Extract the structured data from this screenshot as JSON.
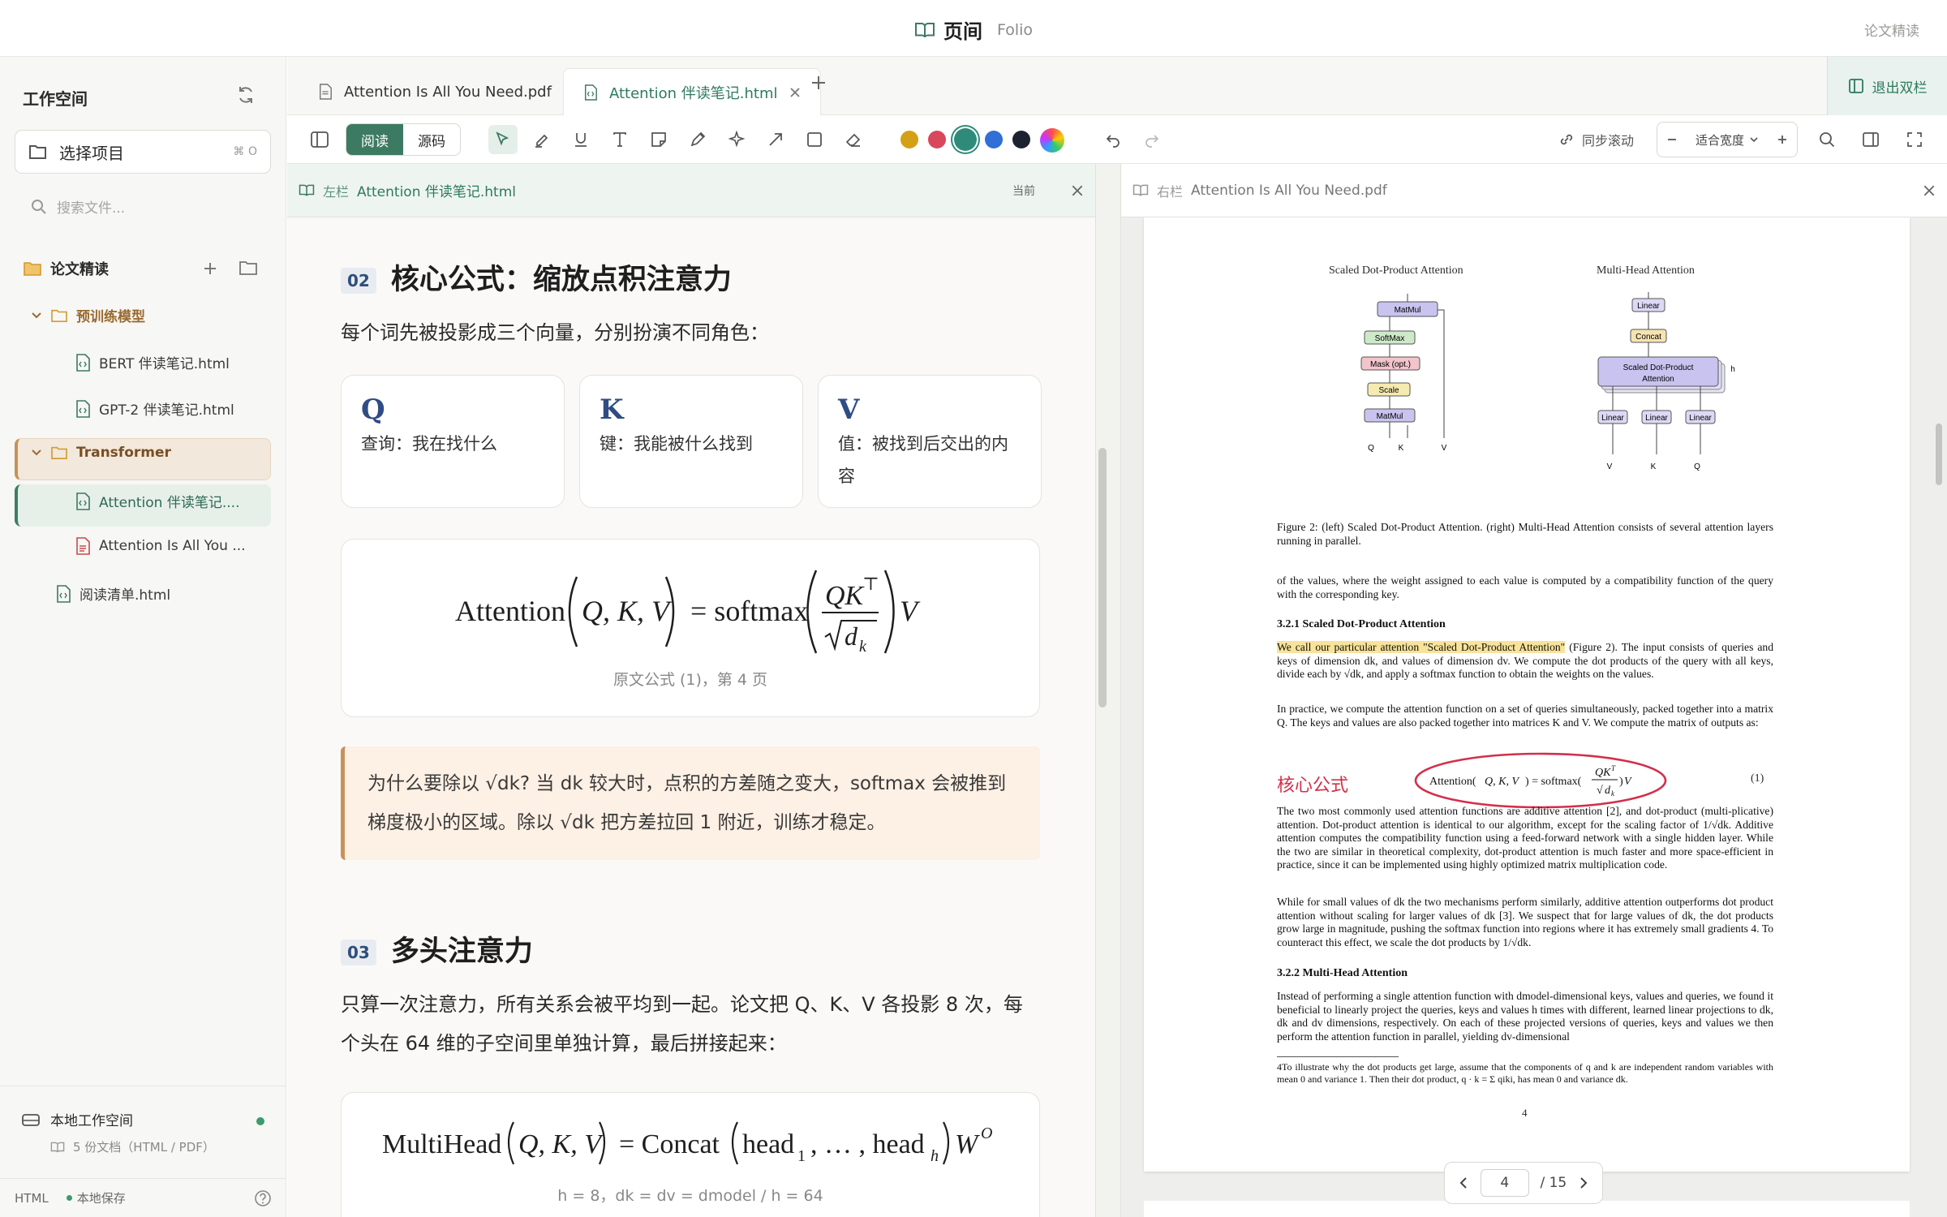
{
  "app": {
    "icon": "book-open-icon",
    "title": "页间",
    "subtitle": "Folio",
    "mode_label": "论文精读",
    "accent": "#3d7a62"
  },
  "sidebar": {
    "title": "工作空间",
    "project_selector": {
      "label": "选择项目",
      "shortcut": "⌘ O"
    },
    "search_placeholder": "搜索文件...",
    "group": "论文精读",
    "items": [
      {
        "label": "预训练模型",
        "type": "folder"
      },
      {
        "label": "BERT 伴读笔记.html",
        "type": "html"
      },
      {
        "label": "GPT-2 伴读笔记.html",
        "type": "html"
      },
      {
        "label": "Transformer",
        "type": "folder"
      },
      {
        "label": "Attention 伴读笔记....",
        "type": "html"
      },
      {
        "label": "Attention Is All You ...",
        "type": "pdf"
      },
      {
        "label": "阅读清单.html",
        "type": "html"
      }
    ],
    "workspace": {
      "name": "本地工作空间",
      "meta": "5 份文档（HTML / PDF）"
    },
    "status": {
      "format": "HTML",
      "save": "本地保存"
    }
  },
  "tabs": [
    {
      "label": "Attention Is All You Need.pdf"
    },
    {
      "label": "Attention 伴读笔记.html"
    }
  ],
  "exit_dual": "退出双栏",
  "toolbar": {
    "mode_read": "阅读",
    "mode_source": "源码",
    "colors": [
      "#d4a017",
      "#d9475a",
      "#2e8b7a",
      "#2f6fd6",
      "#1d2230"
    ],
    "sync_scroll": "同步滚动",
    "zoom": "适合宽度"
  },
  "left_pane": {
    "side": "左栏",
    "file": "Attention 伴读笔记.html",
    "current": "当前",
    "sec2_num": "02",
    "sec2_title": "核心公式：缩放点积注意力",
    "sec2_intro": "每个词先被投影成三个向量，分别扮演不同角色：",
    "q": {
      "letter": "Q",
      "desc": "查询：我在找什么"
    },
    "k": {
      "letter": "K",
      "desc": "键：我能被什么找到"
    },
    "v": {
      "letter": "V",
      "desc": "值：被找到后交出的内容"
    },
    "formula_caption": "原文公式 (1)，第 4 页",
    "note": "为什么要除以 √dk? 当 dk 较大时，点积的方差随之变大，softmax 会被推到梯度极小的区域。除以 √dk 把方差拉回 1 附近，训练才稳定。",
    "sec3_num": "03",
    "sec3_title": "多头注意力",
    "sec3_para": "只算一次注意力，所有关系会被平均到一起。论文把 Q、K、V 各投影 8 次，每个头在 64 维的子空间里单独计算，最后拼接起来：",
    "mh_caption": "h = 8，dk = dv = dmodel / h = 64"
  },
  "right_pane": {
    "side": "右栏",
    "file": "Attention Is All You Need.pdf",
    "fig_left_title": "Scaled Dot-Product Attention",
    "fig_right_title": "Multi-Head Attention",
    "fig_caption": "Figure 2: (left) Scaled Dot-Product Attention. (right) Multi-Head Attention consists of several attention layers running in parallel.",
    "p1": "of the values, where the weight assigned to each value is computed by a compatibility function of the query with the corresponding key.",
    "h321": "3.2.1   Scaled Dot-Product Attention",
    "p2_highlight": "We call our particular attention \"Scaled Dot-Product Attention\"",
    "p2_rest": " (Figure 2). The input consists of queries and keys of dimension dk, and values of dimension dv. We compute the dot products of the query with all keys, divide each by √dk, and apply a softmax function to obtain the weights on the values.",
    "p3": "In practice, we compute the attention function on a set of queries simultaneously, packed together into a matrix Q. The keys and values are also packed together into matrices K and V. We compute the matrix of outputs as:",
    "annotation": "核心公式",
    "eq_num": "(1)",
    "p4": "The two most commonly used attention functions are additive attention [2], and dot-product (multi-plicative) attention. Dot-product attention is identical to our algorithm, except for the scaling factor of 1/√dk. Additive attention computes the compatibility function using a feed-forward network with a single hidden layer. While the two are similar in theoretical complexity, dot-product attention is much faster and more space-efficient in practice, since it can be implemented using highly optimized matrix multiplication code.",
    "p5": "While for small values of dk the two mechanisms perform similarly, additive attention outperforms dot product attention without scaling for larger values of dk [3]. We suspect that for large values of dk, the dot products grow large in magnitude, pushing the softmax function into regions where it has extremely small gradients 4. To counteract this effect, we scale the dot products by 1/√dk.",
    "h322": "3.2.2   Multi-Head Attention",
    "p6": "Instead of performing a single attention function with dmodel-dimensional keys, values and queries, we found it beneficial to linearly project the queries, keys and values h times with different, learned linear projections to dk, dk and dv dimensions, respectively. On each of these projected versions of queries, keys and values we then perform the attention function in parallel, yielding dv-dimensional",
    "footnote": "4To illustrate why the dot products get large, assume that the components of q and k are independent random variables with mean 0 and variance 1. Then their dot product, q · k = Σ qiki, has mean 0 and variance dk.",
    "page_label": "4",
    "pager": {
      "current": "4",
      "total": "/ 15"
    }
  }
}
